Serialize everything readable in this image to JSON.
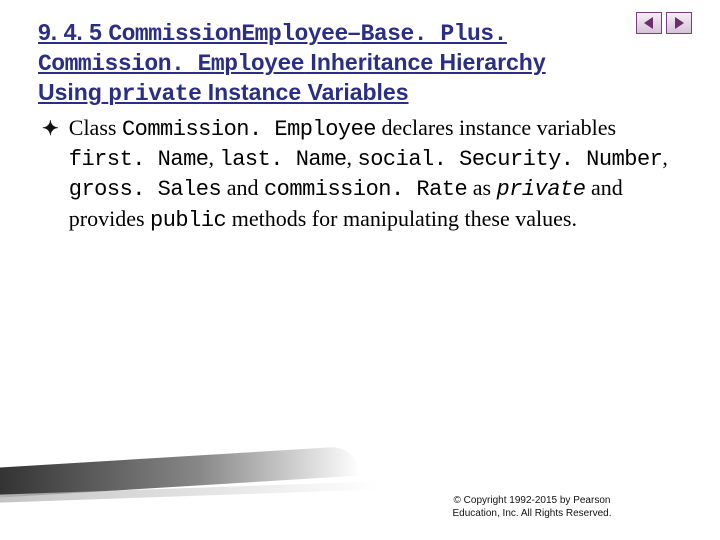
{
  "title": {
    "section_number": "9. 4. 5 ",
    "code1": "CommissionEmployee",
    "dash": "–",
    "code2": "Base. Plus. Commission. Employee",
    "tail": " Inheritance Hierarchy Using ",
    "kw_private": "private",
    "tail2": " Instance Variables"
  },
  "bullet": {
    "lead": "Class ",
    "cls": "Commission. Employee",
    "t1": " declares instance variables ",
    "v1": "first. Name",
    "c1": ", ",
    "v2": "last. Name",
    "c2": ", ",
    "v3": "social. Security. Number",
    "c3": ", ",
    "v4": "gross. Sales",
    "t_and": " and ",
    "v5": "commission. Rate",
    "t_as": " as ",
    "kw_private": "private",
    "t_mid": " and provides ",
    "kw_public": "public",
    "t_end": " methods for manipulating these values."
  },
  "copyright": {
    "line1": "© Copyright 1992-2015 by Pearson",
    "line2": "Education, Inc. All Rights Reserved."
  },
  "nav": {
    "prev": "prev",
    "next": "next"
  }
}
